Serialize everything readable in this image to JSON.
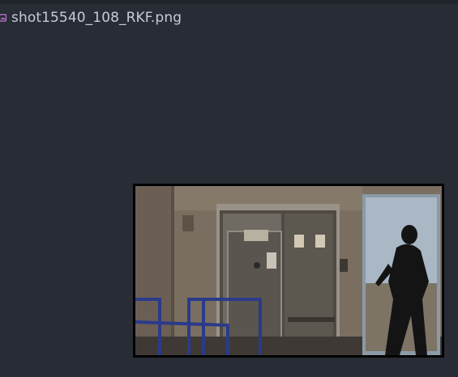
{
  "tab": {
    "filename": "shot15540_108_RKF.png",
    "icon": "image-file-icon"
  },
  "preview": {
    "icon": "photo-preview",
    "accent_color": "#c678dd"
  }
}
